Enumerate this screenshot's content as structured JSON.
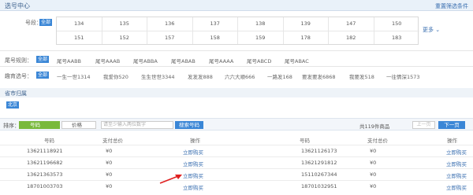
{
  "header": {
    "title": "选号中心",
    "reset": "重置筛选条件"
  },
  "number_filter": {
    "label": "号段：",
    "all_tag": "全部",
    "row1": [
      "134",
      "135",
      "136",
      "137",
      "138",
      "139",
      "147",
      "150"
    ],
    "row2": [
      "151",
      "152",
      "157",
      "158",
      "159",
      "178",
      "182",
      "183"
    ],
    "more": "更多 ⌄"
  },
  "tail_rule": {
    "label": "尾号规则：",
    "all_tag": "全部",
    "items": [
      "尾号AABB",
      "尾号AAAB",
      "尾号ABBA",
      "尾号ABAB",
      "尾号AAAA",
      "尾号ABCD",
      "尾号ABAC"
    ]
  },
  "fun_select": {
    "label": "趣育选号：",
    "all_tag": "全部",
    "items": [
      "一生一世1314",
      "我爱你520",
      "生生世世3344",
      "发发发888",
      "六六大顺666",
      "一路发168",
      "要发要发6868",
      "我要发518",
      "一往情深1573"
    ]
  },
  "province": {
    "title": "省市归属",
    "city_tag": "北京"
  },
  "sort_bar": {
    "label": "排序：",
    "number_btn": "号码",
    "price_btn": "价格",
    "search_placeholder": "请至少输入两位数字",
    "search_btn": "搜索号码",
    "total": "共119件商品",
    "prev": "上一页",
    "next": "下一页"
  },
  "table": {
    "headers": [
      "号码",
      "支付总价",
      "操作",
      "号码",
      "支付总价",
      "操作"
    ],
    "rows": [
      [
        "13621118921",
        "¥0",
        "立即购买",
        "13621126173",
        "¥0",
        "立即购买"
      ],
      [
        "13621196682",
        "¥0",
        "立即购买",
        "13621291812",
        "¥0",
        "立即购买"
      ],
      [
        "13621363573",
        "¥0",
        "立即购买",
        "15110267344",
        "¥0",
        "立即购买"
      ],
      [
        "18701003703",
        "¥0",
        "立即购买",
        "18701032951",
        "¥0",
        "立即购买"
      ]
    ]
  },
  "colors": {
    "accent_blue": "#3a86d6",
    "sort_green": "#79b93c",
    "arrow_red": "#e02020"
  }
}
